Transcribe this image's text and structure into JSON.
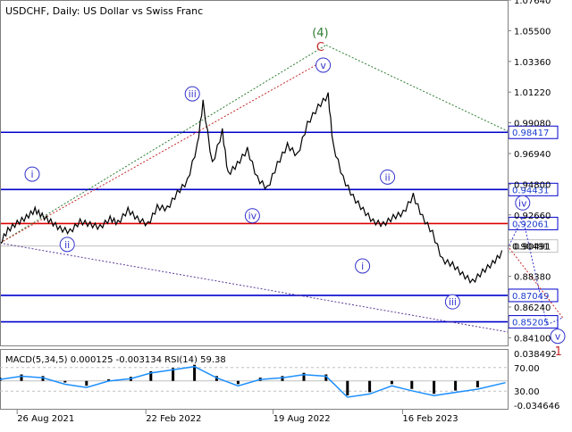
{
  "chart_data": {
    "type": "line",
    "title": "USDCHF, Daily:  US Dollar vs Swiss Franc",
    "colors": {
      "price": "#000000",
      "hline_blue": "#0000cc",
      "hline_red": "#dd0000",
      "hline_gray": "#c0c0c0",
      "label_text": "#1a3dcc",
      "wave_blue": "#3333cc",
      "wave_green": "#2e7d32",
      "wave_red": "#c62828",
      "macd_line": "#1e90ff",
      "macd_hist": "#000000"
    },
    "price_axis": {
      "ylim": [
        0.835,
        1.0764
      ],
      "ticks": [
        "1.07640",
        "1.05500",
        "1.03360",
        "1.01220",
        "0.99080",
        "0.96940",
        "0.94800",
        "0.92660",
        "0.90491",
        "0.88380",
        "0.86240",
        "0.84100"
      ]
    },
    "x_axis": {
      "range": [
        "2021-08-02",
        "2023-07-13"
      ],
      "ticks": [
        {
          "date": "2021-08-26",
          "label": "26 Aug 2021"
        },
        {
          "date": "2022-02-22",
          "label": "22 Feb 2022"
        },
        {
          "date": "2022-08-19",
          "label": "19 Aug 2022"
        },
        {
          "date": "2023-02-16",
          "label": "16 Feb 2023"
        }
      ]
    },
    "levels": [
      {
        "value": 0.98417,
        "label": "0.98417",
        "style": "blue"
      },
      {
        "value": 0.94431,
        "label": "0.94431",
        "style": "blue"
      },
      {
        "value": 0.92061,
        "label": "0.92061",
        "style": "red"
      },
      {
        "value": 0.90491,
        "label": "0.90491",
        "style": "gray"
      },
      {
        "value": 0.87049,
        "label": "0.87049",
        "style": "blue"
      },
      {
        "value": 0.85205,
        "label": "0.85205",
        "style": "blue"
      }
    ],
    "price_series": {
      "name": "USDCHF",
      "x": [
        "2021-08-02",
        "2021-08-13",
        "2021-08-26",
        "2021-09-08",
        "2021-09-20",
        "2021-09-30",
        "2021-10-12",
        "2021-10-25",
        "2021-11-08",
        "2021-11-22",
        "2021-12-06",
        "2021-12-20",
        "2022-01-03",
        "2022-01-14",
        "2022-01-28",
        "2022-02-10",
        "2022-02-25",
        "2022-03-10",
        "2022-03-24",
        "2022-04-07",
        "2022-04-21",
        "2022-05-05",
        "2022-05-13",
        "2022-05-26",
        "2022-06-09",
        "2022-06-17",
        "2022-06-30",
        "2022-07-14",
        "2022-07-28",
        "2022-08-11",
        "2022-08-25",
        "2022-09-08",
        "2022-09-22",
        "2022-10-06",
        "2022-10-21",
        "2022-11-04",
        "2022-11-11",
        "2022-11-25",
        "2022-12-09",
        "2022-12-23",
        "2023-01-06",
        "2023-01-20",
        "2023-02-03",
        "2023-02-17",
        "2023-03-03",
        "2023-03-16",
        "2023-03-30",
        "2023-04-13",
        "2023-04-27",
        "2023-05-11",
        "2023-05-25",
        "2023-06-08",
        "2023-06-22",
        "2023-07-05"
      ],
      "values": [
        0.907,
        0.916,
        0.921,
        0.925,
        0.93,
        0.926,
        0.922,
        0.917,
        0.915,
        0.922,
        0.92,
        0.918,
        0.924,
        0.921,
        0.93,
        0.924,
        0.92,
        0.932,
        0.931,
        0.942,
        0.95,
        0.975,
        1.005,
        0.962,
        0.985,
        0.955,
        0.962,
        0.972,
        0.952,
        0.945,
        0.962,
        0.975,
        0.968,
        0.99,
        1.002,
        1.01,
        0.975,
        0.952,
        0.939,
        0.93,
        0.922,
        0.92,
        0.925,
        0.928,
        0.94,
        0.925,
        0.914,
        0.895,
        0.892,
        0.885,
        0.88,
        0.887,
        0.893,
        0.9
      ]
    },
    "forecast_path": {
      "x": [
        "2023-07-13",
        "2023-08-03",
        "2023-09-06",
        "2023-09-28"
      ],
      "values": [
        0.903,
        0.925,
        0.85,
        0.855
      ]
    },
    "wave_labels": [
      {
        "text": "i",
        "date": "2021-09-16",
        "value": 0.955,
        "style": "circle"
      },
      {
        "text": "ii",
        "date": "2021-11-04",
        "value": 0.906,
        "style": "circle"
      },
      {
        "text": "iii",
        "date": "2022-04-28",
        "value": 1.011,
        "style": "circle"
      },
      {
        "text": "iv",
        "date": "2022-07-21",
        "value": 0.926,
        "style": "circle"
      },
      {
        "text": "v",
        "date": "2022-10-28",
        "value": 1.031,
        "style": "circle"
      },
      {
        "text": "C",
        "date": "2022-10-24",
        "value": 1.044,
        "style": "red"
      },
      {
        "text": "(4)",
        "date": "2022-10-24",
        "value": 1.054,
        "style": "green"
      },
      {
        "text": "i",
        "date": "2022-12-22",
        "value": 0.891,
        "style": "circle"
      },
      {
        "text": "ii",
        "date": "2023-01-26",
        "value": 0.953,
        "style": "circle"
      },
      {
        "text": "iii",
        "date": "2023-04-27",
        "value": 0.866,
        "style": "circle"
      },
      {
        "text": "iv",
        "date": "2023-08-03",
        "value": 0.935,
        "style": "circle"
      },
      {
        "text": "v",
        "date": "2023-09-21",
        "value": 0.842,
        "style": "circle"
      },
      {
        "text": "1",
        "date": "2023-09-22",
        "value": 0.832,
        "style": "red"
      }
    ],
    "indicator": {
      "label": "MACD(5,34,5) 0.000125 -0.003134 RSI(14) 59.38",
      "left_ticks": [
        {
          "label": "0.038492",
          "value": 0.038492
        },
        {
          "label": "-0.034646",
          "value": -0.034646
        }
      ],
      "right_ticks": [
        {
          "label": "70.00",
          "value": 70
        },
        {
          "label": "30.00",
          "value": 30
        }
      ],
      "macd": {
        "x": [
          "2021-08-02",
          "2021-09-01",
          "2021-10-01",
          "2021-11-01",
          "2021-12-01",
          "2022-01-01",
          "2022-02-01",
          "2022-03-01",
          "2022-04-01",
          "2022-05-01",
          "2022-06-01",
          "2022-07-01",
          "2022-08-01",
          "2022-09-01",
          "2022-10-01",
          "2022-11-01",
          "2022-12-01",
          "2023-01-01",
          "2023-02-01",
          "2023-03-01",
          "2023-04-01",
          "2023-05-01",
          "2023-06-01",
          "2023-07-10"
        ],
        "values": [
          0.004,
          0.008,
          0.006,
          -0.002,
          -0.006,
          0.002,
          0.005,
          0.012,
          0.016,
          0.02,
          0.006,
          -0.004,
          0.004,
          0.006,
          0.01,
          0.008,
          -0.018,
          -0.014,
          -0.004,
          -0.01,
          -0.016,
          -0.012,
          -0.008,
          0.0
        ]
      }
    }
  }
}
